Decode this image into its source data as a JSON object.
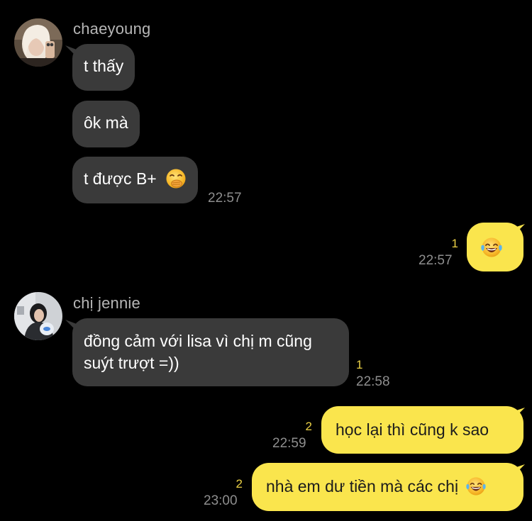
{
  "colors": {
    "background": "#000000",
    "incoming_bubble": "#3a3a3a",
    "outgoing_bubble": "#fae54d",
    "unread_count": "#ead045",
    "timestamp": "#8e8e8e",
    "sender_name": "#b6b6b6"
  },
  "messages": [
    {
      "sender": "chaeyoung",
      "avatar_icon": "profile-photo",
      "bubbles": [
        "t thấy",
        "ôk mà",
        "t được B+"
      ],
      "last_bubble_emoji": "face-with-hand-over-mouth-icon",
      "time": "22:57"
    },
    {
      "outgoing": true,
      "emoji": "face-with-tears-of-joy-icon",
      "unread": "1",
      "time": "22:57"
    },
    {
      "sender": "chị jennie",
      "avatar_icon": "profile-photo",
      "text_line1": "đồng cảm với lisa vì chị m cũng",
      "text_line2": "suýt trượt =))",
      "unread": "1",
      "time": "22:58"
    },
    {
      "outgoing": true,
      "text": "học lại thì cũng k sao",
      "unread": "2",
      "time": "22:59"
    },
    {
      "outgoing": true,
      "text": "nhà em dư tiền mà các chị",
      "emoji": "face-with-tears-of-joy-icon",
      "unread": "2",
      "time": "23:00"
    }
  ]
}
